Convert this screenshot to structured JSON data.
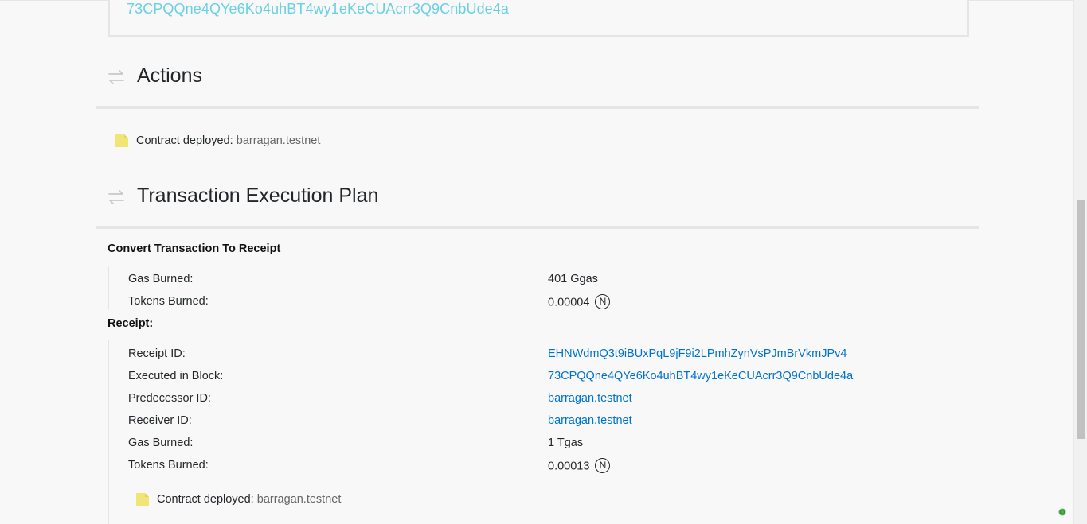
{
  "block_card": {
    "hash": "73CPQQne4QYe6Ko4uhBT4wy1eKeCUAcrr3Q9CnbUde4a"
  },
  "actions_section": {
    "title": "Actions",
    "icon": "transfer-arrows-icon",
    "items": [
      {
        "label": "Contract deployed:",
        "value": "barragan.testnet",
        "icon": "document-icon"
      }
    ]
  },
  "execution_plan": {
    "title": "Transaction Execution Plan",
    "icon": "transfer-arrows-icon",
    "convert": {
      "heading": "Convert Transaction To Receipt",
      "gas_burned_label": "Gas Burned:",
      "gas_burned_value": "401 Ggas",
      "tokens_burned_label": "Tokens Burned:",
      "tokens_burned_value": "0.00004",
      "currency_symbol": "N"
    },
    "receipt": {
      "heading": "Receipt:",
      "receipt_id_label": "Receipt ID:",
      "receipt_id_value": "EHNWdmQ3t9iBUxPqL9jF9i2LPmhZynVsPJmBrVkmJPv4",
      "block_label": "Executed in Block:",
      "block_value": "73CPQQne4QYe6Ko4uhBT4wy1eKeCUAcrr3Q9CnbUde4a",
      "predecessor_label": "Predecessor ID:",
      "predecessor_value": "barragan.testnet",
      "receiver_label": "Receiver ID:",
      "receiver_value": "barragan.testnet",
      "gas_burned_label": "Gas Burned:",
      "gas_burned_value": "1 Tgas",
      "tokens_burned_label": "Tokens Burned:",
      "tokens_burned_value": "0.00013",
      "currency_symbol": "N",
      "action": {
        "label": "Contract deployed:",
        "value": "barragan.testnet",
        "icon": "document-icon"
      }
    }
  },
  "colors": {
    "link": "#0072ce",
    "link_light": "#6ad1e3",
    "divider": "#e5e5e5",
    "doc_icon": "#f0e575",
    "status_dot": "#4caf50"
  }
}
